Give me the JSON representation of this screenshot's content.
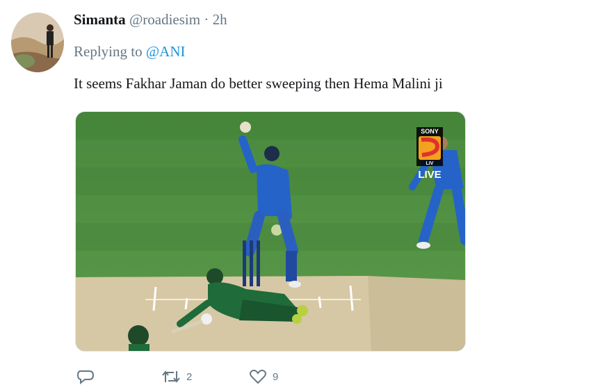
{
  "tweet": {
    "author_name": "Simanta",
    "author_handle": "@roadiesim",
    "separator": "·",
    "time": "2h",
    "replying_prefix": "Replying to",
    "replying_to": "@ANI",
    "text": "It seems Fakhar Jaman do better sweeping then Hema Malini ji"
  },
  "media": {
    "broadcaster_logo": "SONY LIV",
    "live_label": "LIVE"
  },
  "actions": {
    "reply_icon": "comment-icon",
    "retweet_icon": "retweet-icon",
    "retweet_count": "2",
    "like_icon": "heart-icon",
    "like_count": "9"
  },
  "colors": {
    "link": "#1b95e0",
    "muted": "#657786",
    "field": "#4f8a3f",
    "pitch": "#cfc09a",
    "india_kit": "#2563c9",
    "pakistan_kit": "#1f6b3a"
  }
}
